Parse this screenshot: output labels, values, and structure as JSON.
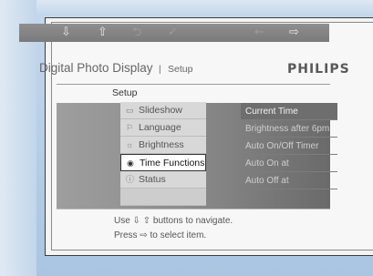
{
  "toolbar": {
    "icons": [
      {
        "name": "arrow-down-icon",
        "glyph": "⇩"
      },
      {
        "name": "arrow-up-icon",
        "glyph": "⇧"
      },
      {
        "name": "back-icon",
        "glyph": "⮌"
      },
      {
        "name": "check-icon",
        "glyph": "✓"
      },
      {
        "name": "arrow-left-icon",
        "glyph": "←"
      },
      {
        "name": "arrow-right-icon",
        "glyph": "⇨"
      }
    ]
  },
  "header": {
    "title": "Digital Photo Display",
    "separator": "|",
    "subtitle": "Setup",
    "brand": "PHILIPS"
  },
  "setup_label": "Setup",
  "menu": {
    "items": [
      {
        "label": "Slideshow",
        "icon": "slideshow-icon",
        "glyph": "▭"
      },
      {
        "label": "Language",
        "icon": "flag-icon",
        "glyph": "⚐"
      },
      {
        "label": "Brightness",
        "icon": "brightness-icon",
        "glyph": "☼"
      },
      {
        "label": "Time Functions",
        "icon": "clock-icon",
        "glyph": "◉",
        "selected": true
      },
      {
        "label": "Status",
        "icon": "status-icon",
        "glyph": "ⓘ"
      }
    ]
  },
  "submenu": {
    "items": [
      "Current Time",
      "Brightness after 6pm",
      "Auto On/Off Timer",
      "Auto On at",
      "Auto Off at"
    ]
  },
  "help": {
    "line1": "Use ⇩ ⇧ buttons to navigate.",
    "line2": "Press ⇨ to select item."
  },
  "colors": {
    "frame": "#b7cfe6",
    "toolbar": "#858585",
    "selected_bg": "#ffffff"
  }
}
